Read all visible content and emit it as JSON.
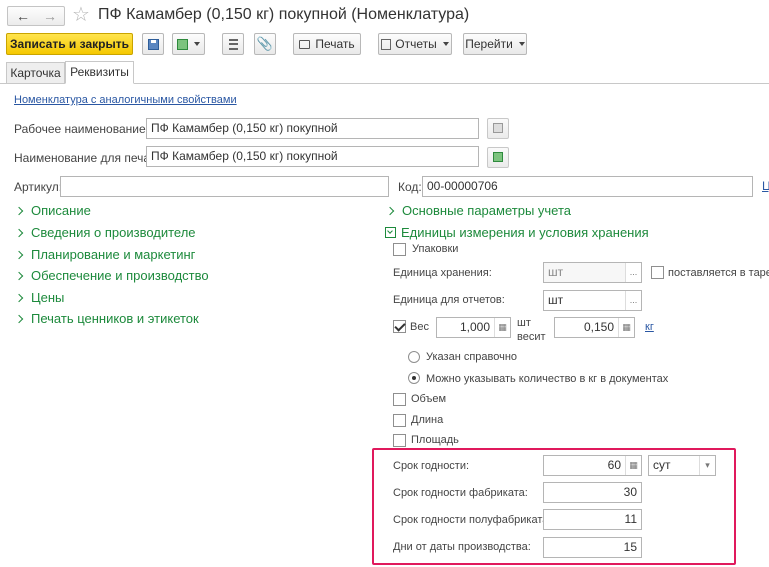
{
  "window": {
    "title": "ПФ Камамбер (0,150 кг) покупной (Номенклатура)"
  },
  "toolbar": {
    "save_close": "Записать и закрыть",
    "print": "Печать",
    "reports": "Отчеты",
    "goto": "Перейти"
  },
  "tabs": [
    {
      "label": "Карточка",
      "active": false
    },
    {
      "label": "Реквизиты",
      "active": true
    }
  ],
  "form": {
    "similar_link": "Номенклатура с аналогичными свойствами",
    "work_name_label": "Рабочее наименование:",
    "work_name_value": "ПФ Камамбер (0,150 кг) покупной",
    "print_name_label": "Наименование для печати:",
    "print_name_value": "ПФ Камамбер (0,150 кг) покупной",
    "article_label": "Артикул:",
    "article_value": "",
    "code_label": "Код:",
    "code_value": "00-00000706",
    "code_link_partial": "Ц"
  },
  "left_groups": [
    "Описание",
    "Сведения о производителе",
    "Планирование и маркетинг",
    "Обеспечение и производство",
    "Цены",
    "Печать ценников и этикеток"
  ],
  "right_groups": {
    "main_params": "Основные параметры учета",
    "units_storage": "Единицы измерения и условия хранения"
  },
  "units": {
    "packaging_label": "Упаковки",
    "storage_unit_label": "Единица хранения:",
    "storage_unit_value": "шт",
    "supplied_in_tare_label": "поставляется в таре",
    "report_unit_label": "Единица для отчетов:",
    "report_unit_value": "шт",
    "weight_label": "Вес",
    "weight_value": "1,000",
    "per_unit_line1": "шт",
    "per_unit_line2": "весит",
    "weight_per_value": "0,150",
    "weight_unit_link": "кг",
    "radio_reference": "Указан справочно",
    "radio_allow_kg": "Можно указывать количество в кг в документах",
    "volume_label": "Объем",
    "length_label": "Длина",
    "area_label": "Площадь"
  },
  "shelf_life": {
    "shelf_life_label": "Срок годности:",
    "shelf_life_value": "60",
    "shelf_life_unit": "сут",
    "factory_label": "Срок годности фабриката:",
    "factory_value": "30",
    "semi_label": "Срок годности полуфабриката:",
    "semi_value": "11",
    "days_label": "Дни от даты производства:",
    "days_value": "15"
  },
  "colors": {
    "group_green": "#1d8a3c",
    "highlight_border": "#e0195c",
    "primary_button": "#f5c800",
    "link_blue": "#2a57a3"
  }
}
